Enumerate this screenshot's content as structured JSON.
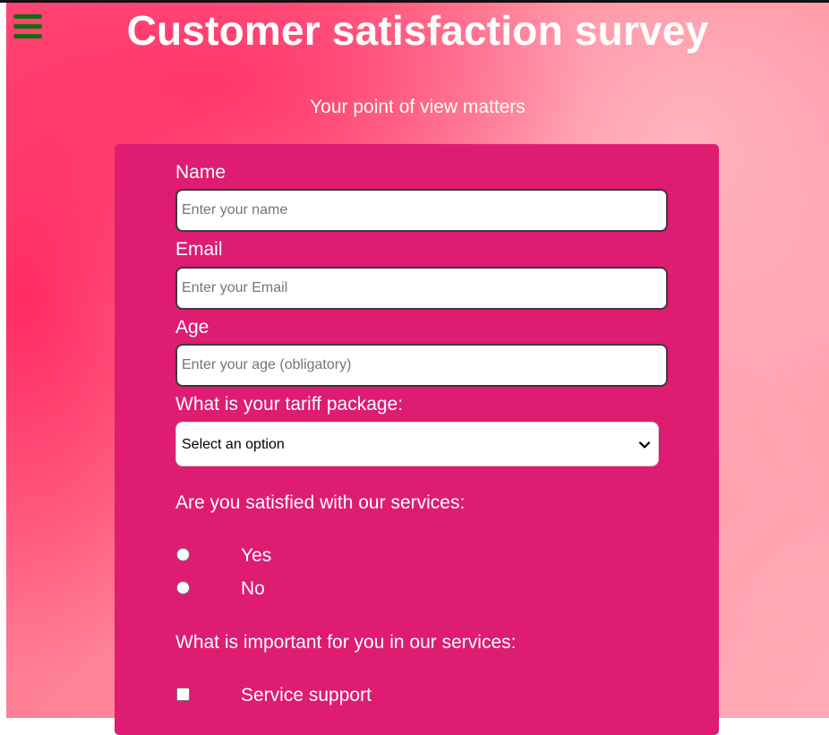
{
  "header": {
    "title": "Customer satisfaction survey",
    "subtitle": "Your point of view matters",
    "menu_icon": "hamburger-menu-icon"
  },
  "form": {
    "name": {
      "label": "Name",
      "placeholder": "Enter your name",
      "value": ""
    },
    "email": {
      "label": "Email",
      "placeholder": "Enter your Email",
      "value": ""
    },
    "age": {
      "label": "Age",
      "placeholder": "Enter your age (obligatory)",
      "value": ""
    },
    "tariff": {
      "label": "What is your tariff package:",
      "selected": "Select an option"
    },
    "satisfied": {
      "question": "Are you satisfied with our services:",
      "options": [
        "Yes",
        "No"
      ]
    },
    "important": {
      "question": "What is important for you in our services:",
      "options": [
        "Service support"
      ]
    }
  },
  "colors": {
    "card": "#dd1c72",
    "menu_icon": "#0f6d10",
    "text": "#ffffff"
  }
}
